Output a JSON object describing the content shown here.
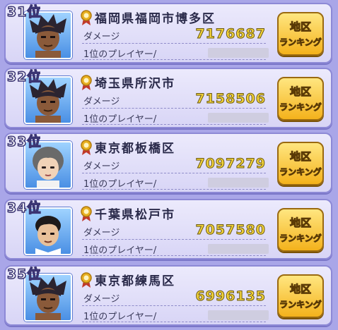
{
  "labels": {
    "damage": "ダメージ",
    "top_player": "1位のプレイヤー/",
    "button_line1": "地区",
    "button_line2": "ランキング"
  },
  "entries": [
    {
      "rank": "31位",
      "region": "福岡県福岡市博多区",
      "damage": "7176687",
      "avatar": "dark-hair-boy"
    },
    {
      "rank": "32位",
      "region": "埼玉県所沢市",
      "damage": "7158506",
      "avatar": "dark-hair-boy"
    },
    {
      "rank": "33位",
      "region": "東京都板橋区",
      "damage": "7097279",
      "avatar": "gray-hair-girl"
    },
    {
      "rank": "34位",
      "region": "千葉県松戸市",
      "damage": "7057580",
      "avatar": "black-hair-man"
    },
    {
      "rank": "35位",
      "region": "東京都練馬区",
      "damage": "6996135",
      "avatar": "dark-hair-boy"
    }
  ],
  "colors": {
    "background": "#a9a6e8",
    "damage_value": "#f2d23a",
    "button": "#f4b21c"
  }
}
